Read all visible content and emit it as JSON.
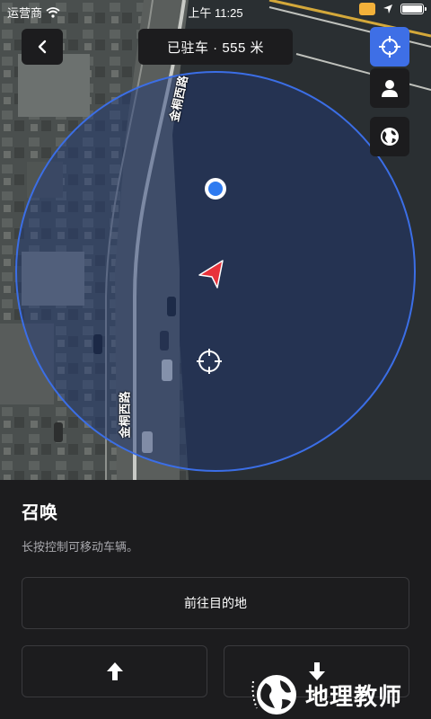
{
  "status_bar": {
    "carrier": "运营商",
    "time": "上午 11:25"
  },
  "header": {
    "title": "已驻车 · 555 米"
  },
  "map": {
    "street_label_top": "金桐西路",
    "street_label_bottom": "金桐西路",
    "radius_circle_color": "#3b6ee6"
  },
  "panel": {
    "title": "召唤",
    "description": "长按控制可移动车辆。",
    "destination_button": "前往目的地"
  },
  "watermark": {
    "text": "地理教师"
  },
  "colors": {
    "accent": "#3e6fe6",
    "car_marker": "#e8323a",
    "panel_bg": "#1c1c1e"
  },
  "icons": [
    "wifi-icon",
    "lock-icon",
    "location-arrow-icon",
    "battery-icon",
    "chevron-left-icon",
    "crosshair-icon",
    "person-icon",
    "globe-icon",
    "arrow-up-icon",
    "arrow-down-icon"
  ]
}
